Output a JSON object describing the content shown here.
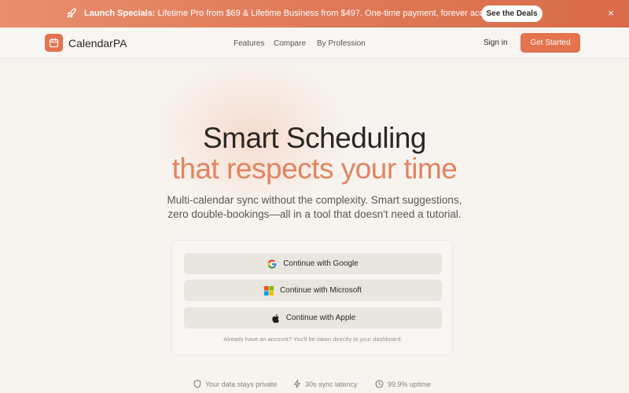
{
  "promo": {
    "prefix": "Launch Specials:",
    "message": " Lifetime Pro from $69 & Lifetime Business from $497. One-time payment, forever access.",
    "cta": "See the Deals",
    "close": "×"
  },
  "nav": {
    "brand": "CalendarPA",
    "links": [
      "Features",
      "Compare",
      "By Profession"
    ],
    "signin": "Sign in",
    "get_started": "Get Started"
  },
  "hero": {
    "title_line1": "Smart Scheduling",
    "title_line2": "that respects your time",
    "subtitle_line1": "Multi-calendar sync without the complexity. Smart suggestions,",
    "subtitle_line2": "zero double-bookings—all in a tool that doesn't need a tutorial."
  },
  "auth": {
    "google": "Continue with Google",
    "microsoft": "Continue with Microsoft",
    "apple": "Continue with Apple",
    "note": "Already have an account? You'll be taken directly to your dashboard."
  },
  "features": {
    "privacy": "Your data stays private",
    "latency": "30s sync latency",
    "uptime": "99.9% uptime"
  },
  "colors": {
    "accent": "#e3744f",
    "accent_text": "#e3835f",
    "promo_bg": "#e07a58",
    "background": "#f7f4f0"
  },
  "icons": [
    "rocket-icon",
    "close-icon",
    "calendar-icon",
    "google-icon",
    "microsoft-icon",
    "apple-icon",
    "shield-icon",
    "lightning-icon",
    "clock-icon"
  ]
}
